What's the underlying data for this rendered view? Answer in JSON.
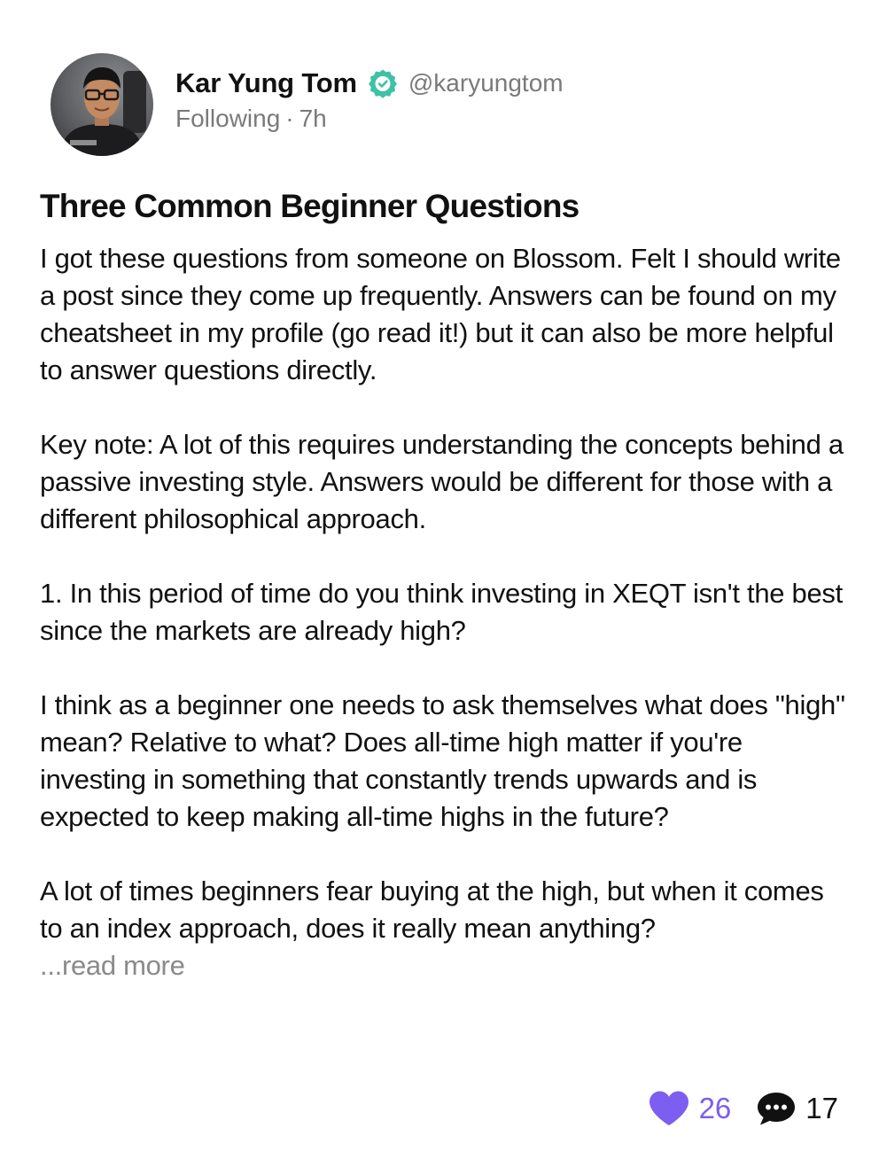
{
  "author": {
    "name": "Kar Yung Tom",
    "handle": "@karyungtom",
    "status": "Following",
    "time": "7h",
    "verified": true,
    "verified_color": "#3fc1a5"
  },
  "post": {
    "title": "Three Common Beginner Questions",
    "paragraphs": [
      "I got these questions from someone on Blossom. Felt I should write a post since they come up frequently. Answers can be found on my cheatsheet in my profile (go read it!) but it can also be more helpful to answer questions directly.",
      "Key note: A lot of this requires understanding the concepts behind a passive investing style. Answers would be different for those with a different philosophical approach.",
      "1. In this period of time do you think investing in XEQT isn't the best since the markets are already high?",
      "I think as a beginner one needs to ask themselves what does \"high\" mean? Relative to what? Does all-time high matter if you're investing in something that constantly trends upwards and is expected to keep making all-time highs in the future?",
      "A lot of times beginners fear buying at the high, but when it comes to an index approach, does it really mean anything?"
    ],
    "read_more": "...read more"
  },
  "actions": {
    "likes": "26",
    "comments": "17",
    "like_color": "#7c5ef0"
  }
}
